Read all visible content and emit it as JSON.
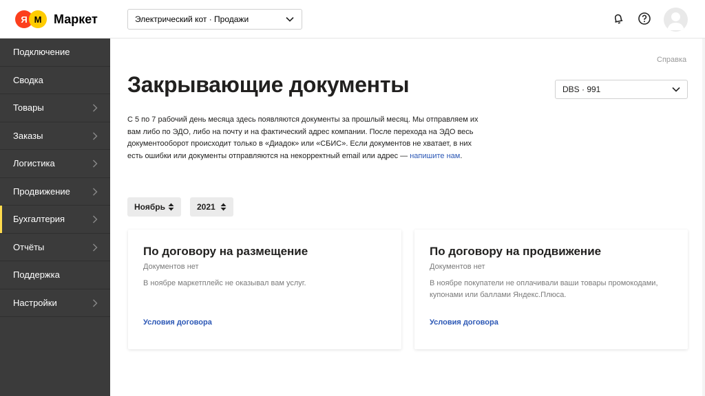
{
  "app": {
    "logo_mark_a": "Я",
    "logo_mark_b": "М",
    "logo_text": "Маркет"
  },
  "header": {
    "shop_select": "Электрический кот · Продажи",
    "icons": [
      "bell-icon",
      "help-icon",
      "avatar"
    ]
  },
  "sidebar": {
    "items": [
      {
        "label": "Подключение",
        "has_arrow": false
      },
      {
        "label": "Сводка",
        "has_arrow": false
      },
      {
        "label": "Товары",
        "has_arrow": true
      },
      {
        "label": "Заказы",
        "has_arrow": true
      },
      {
        "label": "Логистика",
        "has_arrow": true
      },
      {
        "label": "Продвижение",
        "has_arrow": true
      },
      {
        "label": "Бухгалтерия",
        "has_arrow": true,
        "active": true
      },
      {
        "label": "Отчёты",
        "has_arrow": true
      },
      {
        "label": "Поддержка",
        "has_arrow": false
      },
      {
        "label": "Настройки",
        "has_arrow": true
      }
    ],
    "active_color": "#ffdb4d"
  },
  "main": {
    "help_link": "Справка",
    "title": "Закрывающие документы",
    "dbs_select": "DBS · 991",
    "intro_text": "С 5 по 7 рабочий день месяца здесь появляются документы за прошлый месяц. Мы отправляем их вам либо по ЭДО, либо на почту  и на фактический адрес компании. После перехода на ЭДО весь документооборот происходит только в «Диадок» или «СБИС». Если документов не хватает, в них есть ошибки или документы отправляются на некорректный email или адрес — ",
    "intro_link": "напишите нам",
    "intro_end": ".",
    "period": {
      "month": "Ноябрь",
      "year": "2021"
    },
    "cards": [
      {
        "title": "По договору на размещение",
        "status": "Документов нет",
        "text": "В ноябре маркетплейс не оказывал вам услуг.",
        "link": "Условия договора"
      },
      {
        "title": "По договору на продвижение",
        "status": "Документов нет",
        "text": "В ноябре покупатели не оплачивали ваши товары промокодами, купонами или баллами Яндекс.Плюса.",
        "link": "Условия договора"
      }
    ]
  },
  "colors": {
    "sidebar_bg": "#3b3b3b",
    "link": "#2b57b5",
    "logo_red": "#fc3f1d",
    "logo_yellow": "#ffcc00"
  }
}
